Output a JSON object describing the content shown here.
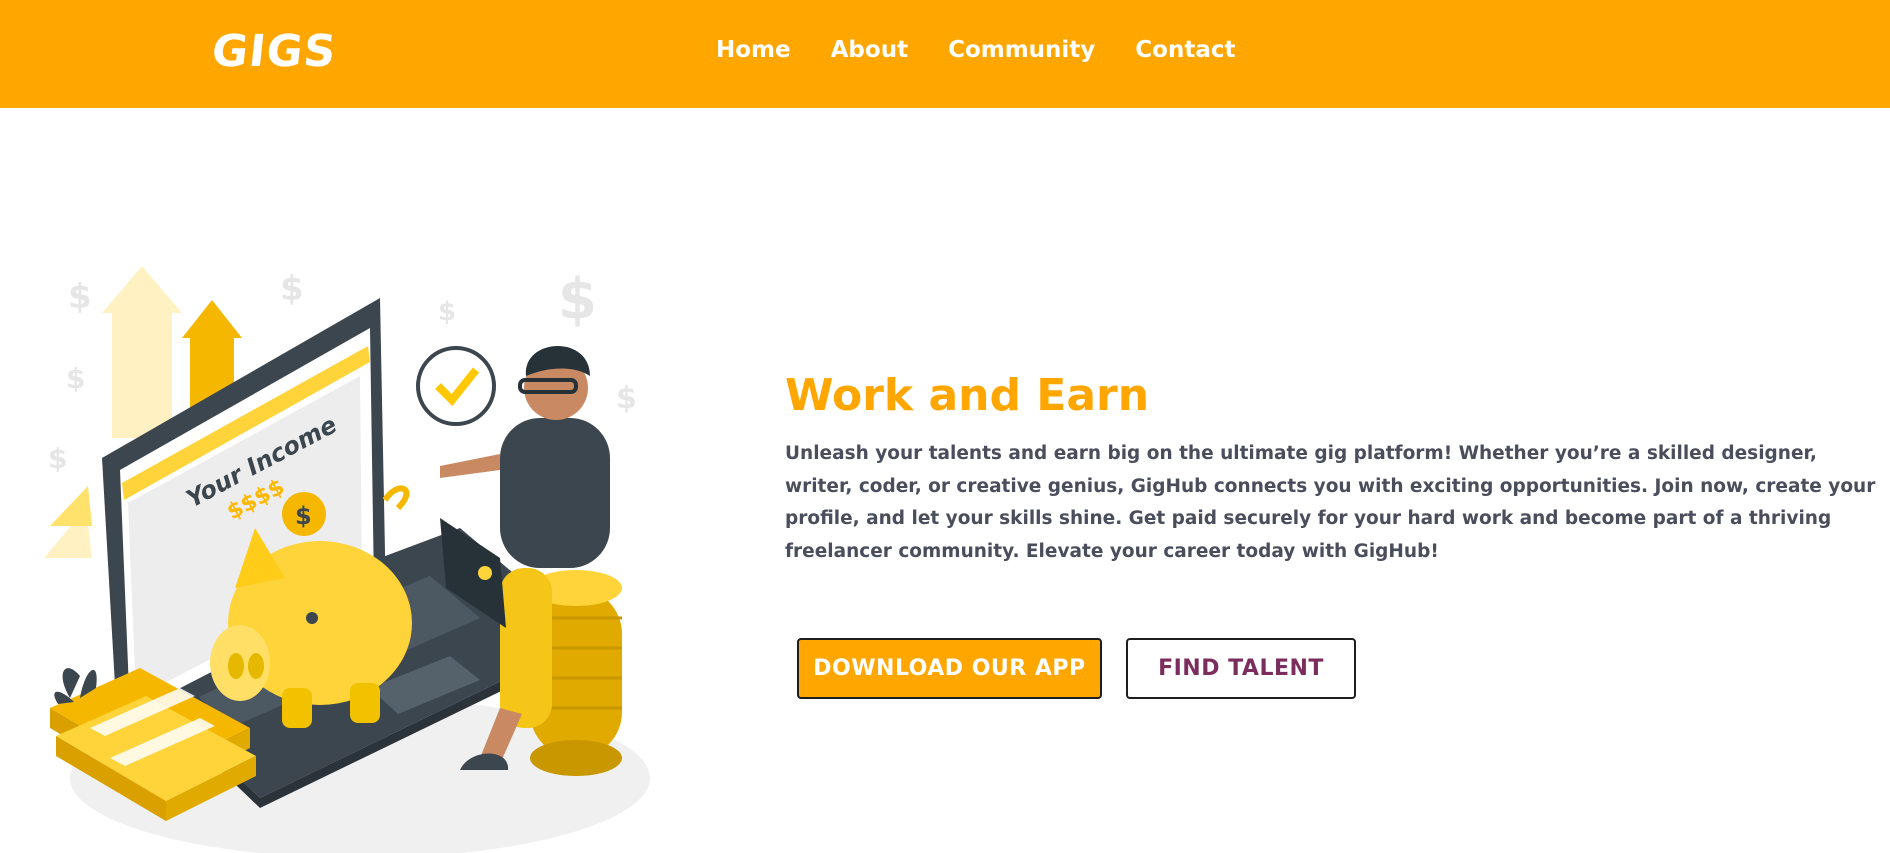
{
  "header": {
    "logo": "GIGS",
    "nav": [
      "Home",
      "About",
      "Community",
      "Contact"
    ]
  },
  "hero": {
    "title": "Work and Earn",
    "description": "Unleash your talents and earn big on the ultimate gig platform! Whether you’re a skilled designer, writer, coder, or creative genius, GigHub connects you with exciting opportunities. Join now, create your profile, and let your skills shine. Get paid securely for your hard work and become part of a thriving freelancer community. Elevate your career today with GigHub!",
    "buttons": {
      "download": "DOWNLOAD OUR APP",
      "find_talent": "FIND TALENT"
    },
    "illustration": {
      "screen_title": "Your Income",
      "screen_amount": "$$$$"
    }
  },
  "colors": {
    "brand": "#ffa600",
    "text": "#4a4e5c",
    "accent_text": "#7b2d5e",
    "illustration_yellow": "#ffd43b",
    "illustration_dark": "#3c464f"
  }
}
